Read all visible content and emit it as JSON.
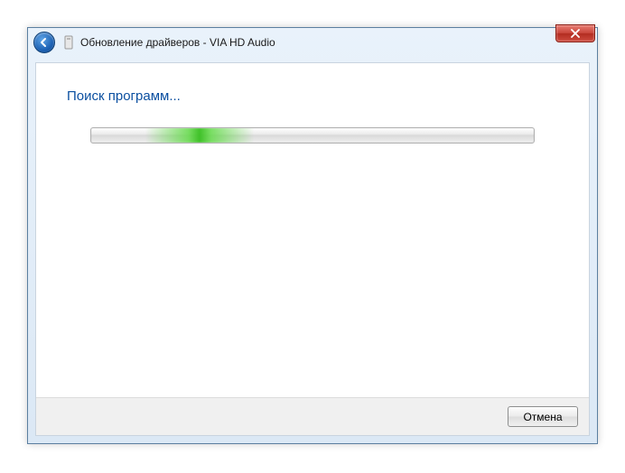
{
  "window": {
    "title": "Обновление драйверов - VIA HD Audio"
  },
  "content": {
    "heading": "Поиск программ..."
  },
  "footer": {
    "cancel_label": "Отмена"
  }
}
